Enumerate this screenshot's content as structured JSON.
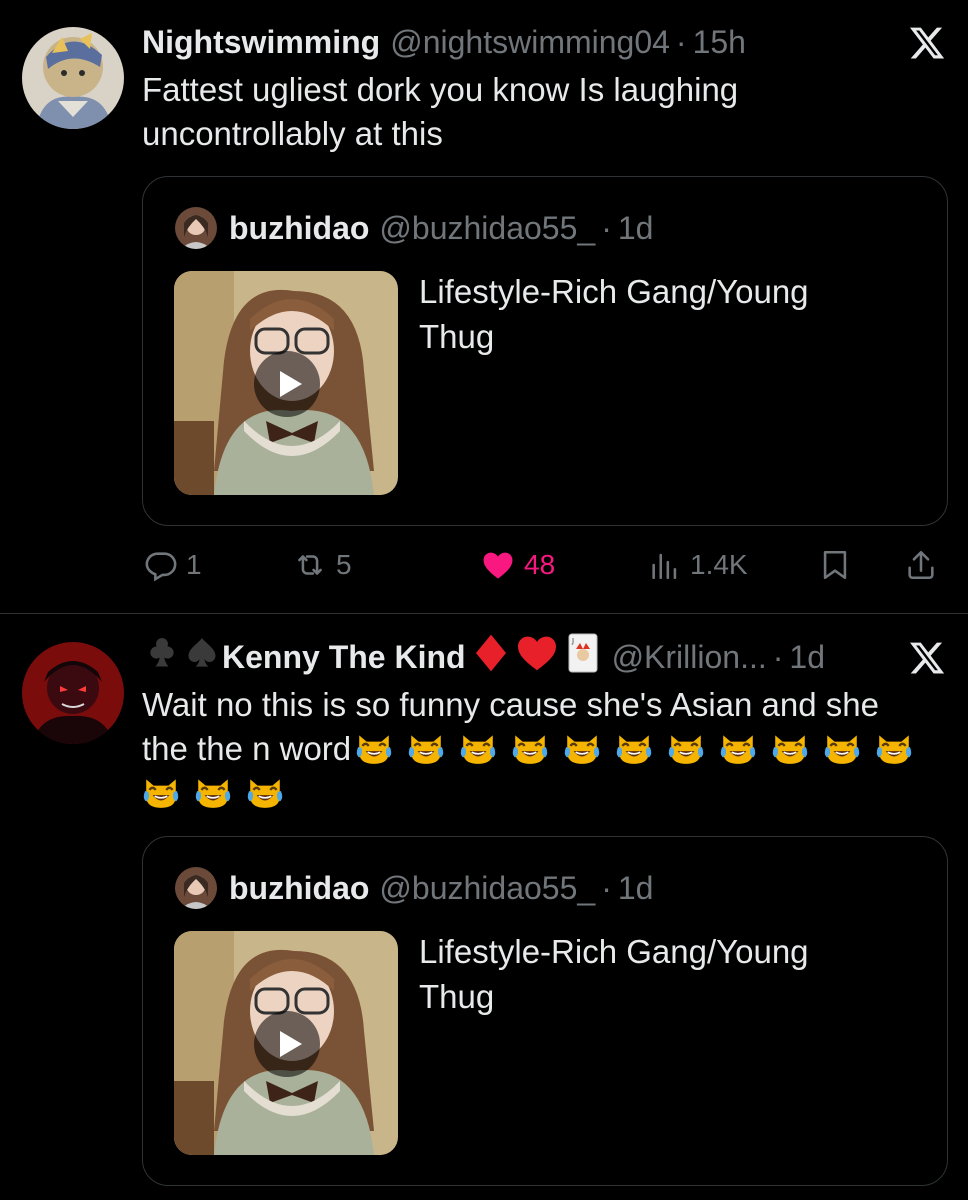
{
  "tweets": [
    {
      "name": "Nightswimming",
      "handle": "@nightswimming04",
      "dot": "·",
      "time": "15h",
      "text": "Fattest ugliest dork you know Is laughing uncontrollably at this",
      "quote": {
        "name": "buzhidao",
        "handle": "@buzhidao55_",
        "dot": "·",
        "time": "1d",
        "text": "Lifestyle-Rich Gang/Young Thug"
      },
      "actions": {
        "replies": "1",
        "reposts": "5",
        "likes": "48",
        "views": "1.4K"
      }
    },
    {
      "name": "Kenny The Kind",
      "handle": "@Krillion...",
      "dot": "·",
      "time": "1d",
      "text_line1": "Wait no this is so funny cause she's Asian and she",
      "text_line2_prefix": "the the n word",
      "emoji_count": 14,
      "emoji_name": "crying-laughing-cat-emoji",
      "quote": {
        "name": "buzhidao",
        "handle": "@buzhidao55_",
        "dot": "·",
        "time": "1d",
        "text": "Lifestyle-Rich Gang/Young Thug"
      }
    }
  ],
  "colors": {
    "background": "#000000",
    "text": "#e7e9ea",
    "secondary": "#71767b",
    "border": "#2f3336",
    "like": "#f91880"
  },
  "icons": [
    "x-logo-icon",
    "reply-icon",
    "repost-icon",
    "heart-icon",
    "views-icon",
    "bookmark-icon",
    "share-icon",
    "play-icon",
    "club-suit-icon",
    "spade-suit-icon",
    "diamond-suit-icon",
    "heart-suit-icon",
    "joker-card-icon"
  ]
}
